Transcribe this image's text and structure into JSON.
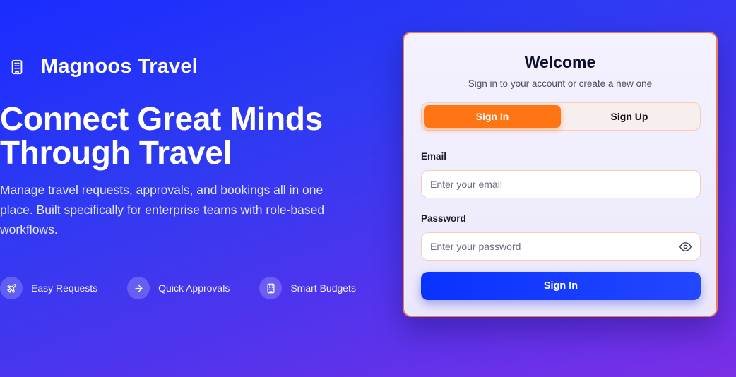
{
  "brand": {
    "name": "Magnoos Travel",
    "icon": "building-icon"
  },
  "hero": {
    "headline_line1": "Connect Great Minds",
    "headline_line2": "Through Travel",
    "subtext": "Manage travel requests, approvals, and bookings all in one place. Built specifically for enterprise teams with role-based workflows."
  },
  "features": [
    {
      "label": "Easy Requests",
      "icon": "plane-icon"
    },
    {
      "label": "Quick Approvals",
      "icon": "arrow-right-icon"
    },
    {
      "label": "Smart Budgets",
      "icon": "building-icon"
    }
  ],
  "card": {
    "title": "Welcome",
    "subtitle": "Sign in to your account or create a new one",
    "tabs": [
      {
        "label": "Sign In",
        "active": true
      },
      {
        "label": "Sign Up",
        "active": false
      }
    ],
    "email": {
      "label": "Email",
      "placeholder": "Enter your email",
      "value": ""
    },
    "password": {
      "label": "Password",
      "placeholder": "Enter your password",
      "value": "",
      "toggle_icon": "eye-icon"
    },
    "submit_label": "Sign In"
  },
  "colors": {
    "accent_orange": "#ff7413",
    "primary_blue": "#0a32ff",
    "card_border": "#f07c4a"
  }
}
